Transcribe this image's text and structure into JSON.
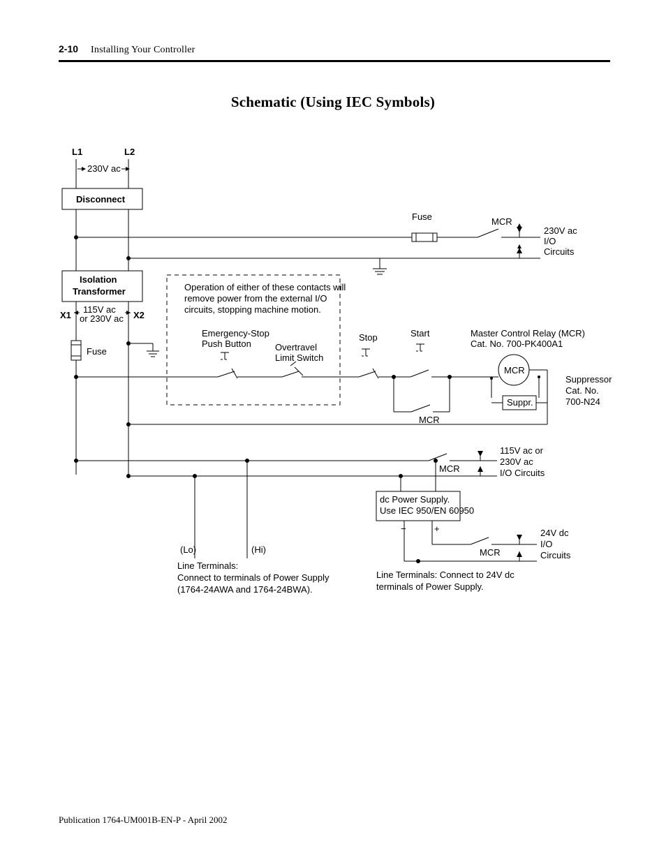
{
  "header": {
    "page_number": "2-10",
    "section": "Installing Your Controller"
  },
  "title": "Schematic (Using IEC Symbols)",
  "labels": {
    "L1": "L1",
    "L2": "L2",
    "v230ac": "230V ac",
    "disconnect": "Disconnect",
    "fuse_top": "Fuse",
    "mcr_top": "MCR",
    "io230_1": "230V ac",
    "io230_2": "I/O",
    "io230_3": "Circuits",
    "iso1": "Isolation",
    "iso2": "Transformer",
    "X1": "X1",
    "X2": "X2",
    "v115_1": "115V ac",
    "v115_2": "or 230V ac",
    "fuse_left": "Fuse",
    "note1": "Operation of either of these contacts will",
    "note2": "remove power from the external I/O",
    "note3": "circuits, stopping machine motion.",
    "estop1": "Emergency-Stop",
    "estop2": "Push Button",
    "overtravel1": "Overtravel",
    "overtravel2": "Limit Switch",
    "stop": "Stop",
    "start": "Start",
    "mcr_relay1": "Master Control Relay (MCR)",
    "mcr_relay2": "Cat. No. 700-PK400A1",
    "mcr_coil": "MCR",
    "suppr": "Suppr.",
    "suppressor1": "Suppressor",
    "suppressor2": "Cat. No.",
    "suppressor3": "700-N24",
    "mcr_aux": "MCR",
    "mcr_mid": "MCR",
    "io115_1": "115V ac or",
    "io115_2": "230V ac",
    "io115_3": "I/O Circuits",
    "dcps1": "dc Power Supply.",
    "dcps2": "Use IEC 950/EN 60950",
    "minus": "−",
    "plus": "+",
    "mcr_bot": "MCR",
    "io24_1": "24V dc",
    "io24_2": "I/O",
    "io24_3": "Circuits",
    "lo": "(Lo)",
    "hi": "(Hi)",
    "lineterm1": "Line Terminals:",
    "lineterm2": "Connect to terminals of Power Supply",
    "lineterm3": "(1764-24AWA and 1764-24BWA).",
    "lineterm24_1": "Line Terminals: Connect to 24V dc",
    "lineterm24_2": "terminals of Power Supply."
  },
  "footer": "Publication 1764-UM001B-EN-P - April 2002"
}
